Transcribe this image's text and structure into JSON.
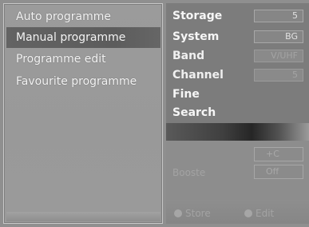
{
  "left_menu": {
    "items": [
      {
        "label": "Auto programme",
        "selected": false
      },
      {
        "label": "Manual programme",
        "selected": true
      },
      {
        "label": "Programme edit",
        "selected": false
      },
      {
        "label": "Favourite programme",
        "selected": false
      }
    ]
  },
  "right_menu": {
    "rows": [
      {
        "label": "Storage",
        "value": "5"
      },
      {
        "label": "System",
        "value": "BG"
      },
      {
        "label": "Band",
        "value": "V/UHF"
      },
      {
        "label": "Channel",
        "value": "5"
      },
      {
        "label": "Fine",
        "value": ""
      },
      {
        "label": "Search",
        "value": ""
      }
    ],
    "lower": {
      "button_label": "+C",
      "booster_label": "Booste",
      "booster_value": "Off"
    },
    "footer": {
      "store_label": "Store",
      "edit_label": "Edit"
    }
  },
  "colors": {
    "panel_bg": "#9a9a9a",
    "selected_row": "#5f5f5f",
    "text": "#f4f4f4"
  }
}
